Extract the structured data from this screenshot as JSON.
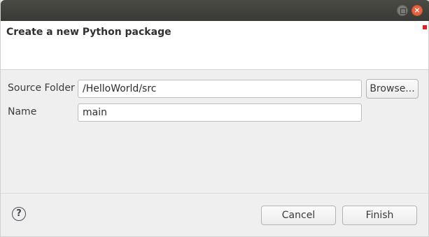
{
  "dialog": {
    "title": "Create a new Python package"
  },
  "form": {
    "source_folder_label": "Source Folder",
    "source_folder_value": "/HelloWorld/src",
    "browse_label": "Browse...",
    "name_label": "Name",
    "name_value": "main"
  },
  "footer": {
    "help_glyph": "?",
    "cancel_label": "Cancel",
    "finish_label": "Finish"
  },
  "titlebar": {
    "close_glyph": "×"
  },
  "colors": {
    "titlebar": "#3e3e3a",
    "close_button": "#e9603f",
    "header_background": "#ffffff",
    "body_background": "#efefef"
  },
  "icons": [
    "maximize-icon",
    "close-icon",
    "help-icon"
  ]
}
